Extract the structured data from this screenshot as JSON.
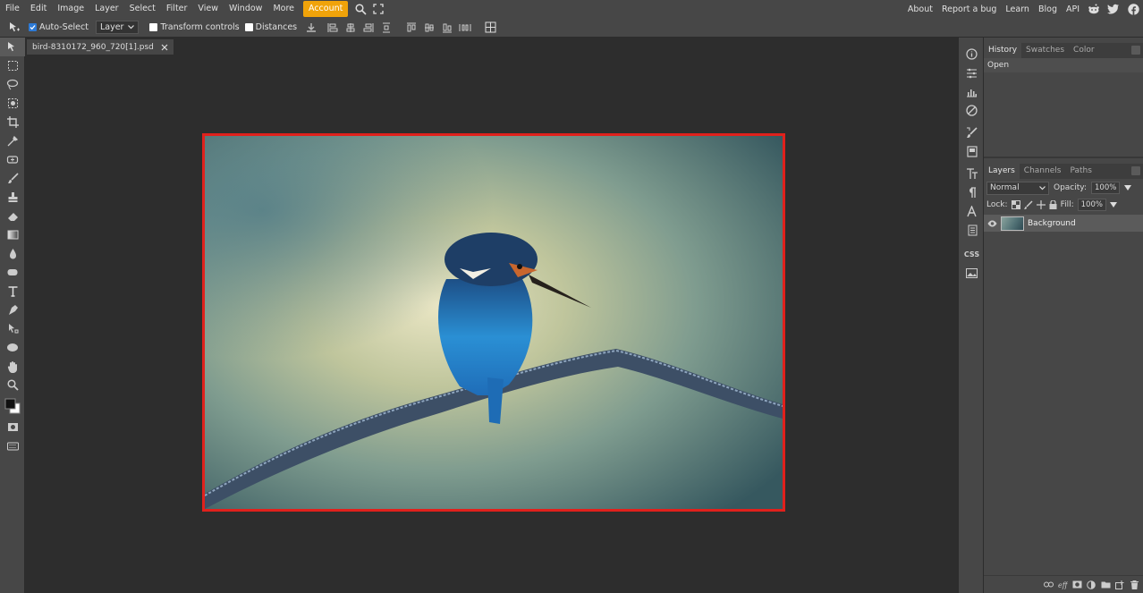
{
  "menubar": {
    "items": [
      "File",
      "Edit",
      "Image",
      "Layer",
      "Select",
      "Filter",
      "View",
      "Window",
      "More"
    ],
    "account": "Account",
    "right_links": [
      "About",
      "Report a bug",
      "Learn",
      "Blog",
      "API"
    ],
    "icons": [
      "search-icon",
      "fullscreen-icon",
      "reddit-icon",
      "twitter-icon",
      "facebook-icon"
    ],
    "accent": "#f0a30a"
  },
  "options": {
    "auto_select_label": "Auto-Select",
    "auto_select_checked": true,
    "target_value": "Layer",
    "transform_label": "Transform controls",
    "distances_label": "Distances"
  },
  "document": {
    "tab_title": "bird-8310172_960_720[1].psd",
    "selection_color": "#e0211c"
  },
  "panels": {
    "top_tabs": [
      "History",
      "Swatches",
      "Color"
    ],
    "history_items": [
      "Open"
    ],
    "layer_tabs": [
      "Layers",
      "Channels",
      "Paths"
    ],
    "blend_mode": "Normal",
    "opacity_label": "Opacity:",
    "opacity_value": "100%",
    "lock_label": "Lock:",
    "fill_label": "Fill:",
    "fill_value": "100%",
    "layers": [
      {
        "name": "Background",
        "visible": true
      }
    ]
  },
  "sidebar_icons": [
    "info-icon",
    "properties-icon",
    "histogram-icon",
    "navigator-icon",
    "brush-settings-icon",
    "swatch-icon",
    "character-icon",
    "paragraph-icon",
    "glyph-icon",
    "layer-comps-icon",
    "css-icon",
    "image-icon"
  ],
  "sidebar_css_label": "CSS"
}
